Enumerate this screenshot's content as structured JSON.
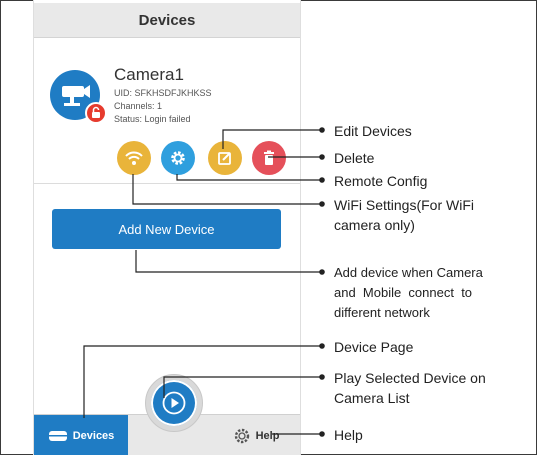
{
  "screen": {
    "title": "Devices",
    "camera": {
      "name": "Camera1",
      "uid": "UID: SFKHSDFJKHKSS",
      "channels": "Channels: 1",
      "status": "Status: Login failed"
    },
    "actions": [
      {
        "icon": "wifi-icon",
        "color": "#e9b43a"
      },
      {
        "icon": "gear-icon",
        "color": "#2f9fde"
      },
      {
        "icon": "edit-icon",
        "color": "#e9b43a"
      },
      {
        "icon": "trash-icon",
        "color": "#e5505a"
      }
    ],
    "add_button": "Add New Device",
    "tabs": {
      "devices": "Devices",
      "help": "Help"
    }
  },
  "annotations": {
    "edit": "Edit Devices",
    "delete": "Delete",
    "remote": "Remote Config",
    "wifi_1": "WiFi Settings(For WiFi",
    "wifi_2": "camera only)",
    "add_1": "Add device when Camera",
    "add_2": "and  Mobile  connect  to",
    "add_3": "different network",
    "device_page": "Device Page",
    "play_1": "Play Selected Device on",
    "play_2": "Camera List",
    "help": "Help"
  },
  "colors": {
    "accent": "#1f7cc4",
    "warning": "#e9b43a",
    "danger": "#e5505a",
    "config": "#2f9fde"
  }
}
